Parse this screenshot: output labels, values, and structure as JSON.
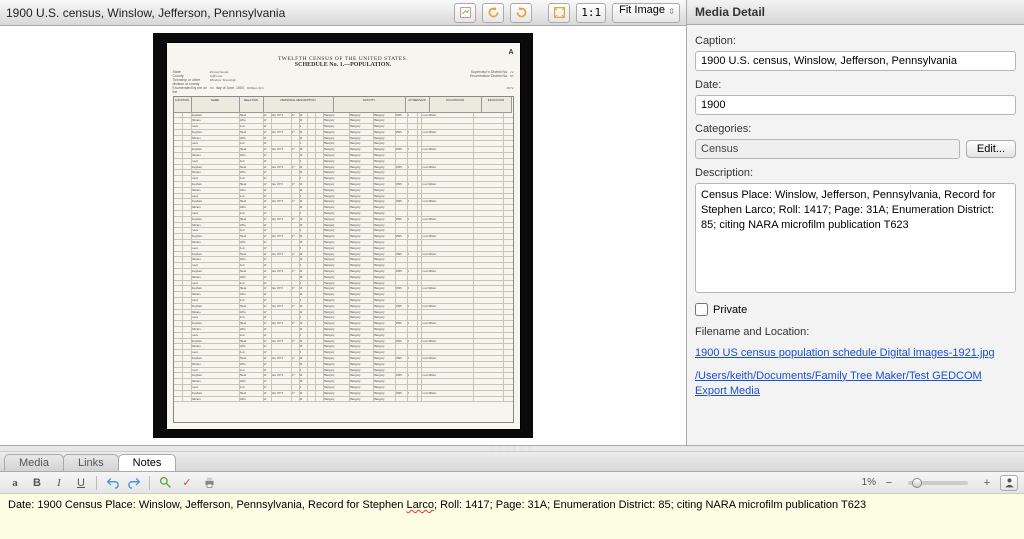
{
  "viewer": {
    "title": "1900 U.S. census, Winslow, Jefferson, Pennsylvania",
    "fit_label": "Fit Image",
    "one_to_one": "1:1",
    "icons": {
      "edit": "edit-image-icon",
      "rotate_left": "rotate-left-icon",
      "rotate_right": "rotate-right-icon",
      "fit": "fit-icon"
    }
  },
  "document": {
    "banner": "TWELFTH CENSUS OF THE UNITED STATES.",
    "schedule": "SCHEDULE No. 1.—POPULATION.",
    "sheet_letter": "A",
    "state_label": "State",
    "state_value": "Pennsylvania",
    "county_label": "County",
    "county_value": "Jefferson",
    "township_label": "Township or other division of county",
    "township_value": "Winslow Township",
    "supervisor_label": "Supervisor's District No.",
    "supervisor_value": "14",
    "enum_label": "Enumeration District No.",
    "enum_value": "85",
    "enumerated_label": "Enumerated by me on the",
    "enumerated_day": "7th",
    "enumerated_month": "day of June, 1900,",
    "enumerator": "William Syh",
    "page_margin": "9674",
    "columns_hint": [
      "LOCATION",
      "NAME",
      "RELATION",
      "PERSONAL DESCRIPTION",
      "NATIVITY",
      "CITIZENSHIP",
      "OCCUPATION",
      "EDUCATION"
    ],
    "rows_sample": [
      [
        "",
        "Stephen",
        "Head",
        "W",
        "M",
        "Jan 1873",
        "27",
        "M",
        "",
        "",
        "Hungary",
        "Hungary",
        "Hungary",
        "1895",
        "5",
        "",
        "Coal Miner"
      ],
      [
        "",
        "Juliana",
        "Wife",
        "W",
        "F",
        "",
        "",
        "M",
        "",
        "",
        "Hungary",
        "Hungary",
        "Hungary",
        "",
        "",
        "",
        ""
      ],
      [
        "",
        "Geza",
        "Son",
        "W",
        "M",
        "",
        "",
        "S",
        "",
        "",
        "Hungary",
        "Hungary",
        "Hungary",
        "",
        "",
        "",
        ""
      ]
    ]
  },
  "detail": {
    "panel_title": "Media Detail",
    "caption_label": "Caption:",
    "caption_value": "1900 U.S. census, Winslow, Jefferson, Pennsylvania",
    "date_label": "Date:",
    "date_value": "1900",
    "categories_label": "Categories:",
    "categories_value": "Census",
    "edit_button": "Edit...",
    "description_label": "Description:",
    "description_value": "Census Place: Winslow, Jefferson, Pennsylvania, Record for Stephen Larco; Roll: 1417; Page: 31A; Enumeration District: 85; citing NARA microfilm publication T623",
    "private_label": "Private",
    "private_checked": false,
    "filename_label": "Filename and Location:",
    "filename_link": "1900 US census population schedule Digital images-1921.jpg",
    "location_link": "/Users/keith/Documents/Family Tree Maker/Test GEDCOM Export Media"
  },
  "tabs": {
    "media": "Media",
    "links": "Links",
    "notes": "Notes",
    "active": "notes"
  },
  "notes_toolbar": {
    "zoom_pct": "1%"
  },
  "notes": {
    "text_pre": "Date: 1900 Census Place: Winslow, Jefferson, Pennsylvania, Record for Stephen ",
    "wavy_word": "Larco",
    "text_post": "; Roll: 1417; Page: 31A; Enumeration District: 85; citing NARA microfilm publication T623"
  }
}
